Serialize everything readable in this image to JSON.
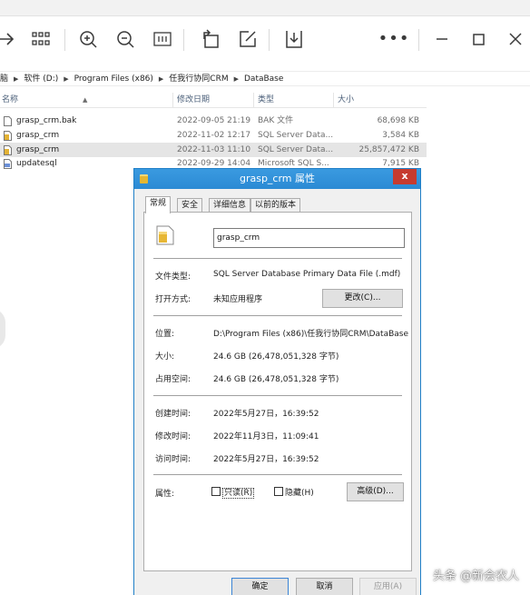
{
  "toolbar": {
    "icons": [
      "forward-arrow-icon",
      "view-grid-icon",
      "zoom-in-icon",
      "zoom-out-icon",
      "fit-screen-icon",
      "rotate-icon",
      "edit-icon",
      "download-icon",
      "more-icon",
      "minimize-icon",
      "maximize-icon",
      "close-icon"
    ]
  },
  "breadcrumb": [
    "脑",
    "软件 (D:)",
    "Program Files (x86)",
    "任我行协同CRM",
    "DataBase"
  ],
  "columns": {
    "name": "名称",
    "date": "修改日期",
    "type": "类型",
    "size": "大小"
  },
  "files": [
    {
      "name": "grasp_crm.bak",
      "date": "2022-09-05 21:19",
      "type": "BAK 文件",
      "size": "68,698 KB",
      "icon": "document-icon"
    },
    {
      "name": "grasp_crm",
      "date": "2022-11-02 12:17",
      "type": "SQL Server Data...",
      "size": "3,584 KB",
      "icon": "database-file-icon"
    },
    {
      "name": "grasp_crm",
      "date": "2022-11-03 11:10",
      "type": "SQL Server Data...",
      "size": "25,857,472 KB",
      "icon": "database-file-icon"
    },
    {
      "name": "updatesql",
      "date": "2022-09-29 14:04",
      "type": "Microsoft SQL S...",
      "size": "7,915 KB",
      "icon": "sql-file-icon"
    }
  ],
  "dialog": {
    "title": "grasp_crm 属性",
    "tabs": [
      "常规",
      "安全",
      "详细信息",
      "以前的版本"
    ],
    "active_tab": "常规",
    "filename": "grasp_crm",
    "file_type_label": "文件类型:",
    "file_type": "SQL Server Database Primary Data File (.mdf)",
    "open_with_label": "打开方式:",
    "open_with": "未知应用程序",
    "change_button": "更改(C)...",
    "location_label": "位置:",
    "location": "D:\\Program Files (x86)\\任我行协同CRM\\DataBase",
    "size_label": "大小:",
    "size": "24.6 GB (26,478,051,328 字节)",
    "size_on_disk_label": "占用空间:",
    "size_on_disk": "24.6 GB (26,478,051,328 字节)",
    "created_label": "创建时间:",
    "created": "2022年5月27日，16:39:52",
    "modified_label": "修改时间:",
    "modified": "2022年11月3日，11:09:41",
    "accessed_label": "访问时间:",
    "accessed": "2022年5月27日，16:39:52",
    "attributes_label": "属性:",
    "readonly_label": "只读(R)",
    "hidden_label": "隐藏(H)",
    "advanced_button": "高级(D)...",
    "ok_button": "确定",
    "cancel_button": "取消",
    "apply_button": "应用(A)",
    "close_glyph": "x"
  },
  "watermark": "头条 @新会农人"
}
